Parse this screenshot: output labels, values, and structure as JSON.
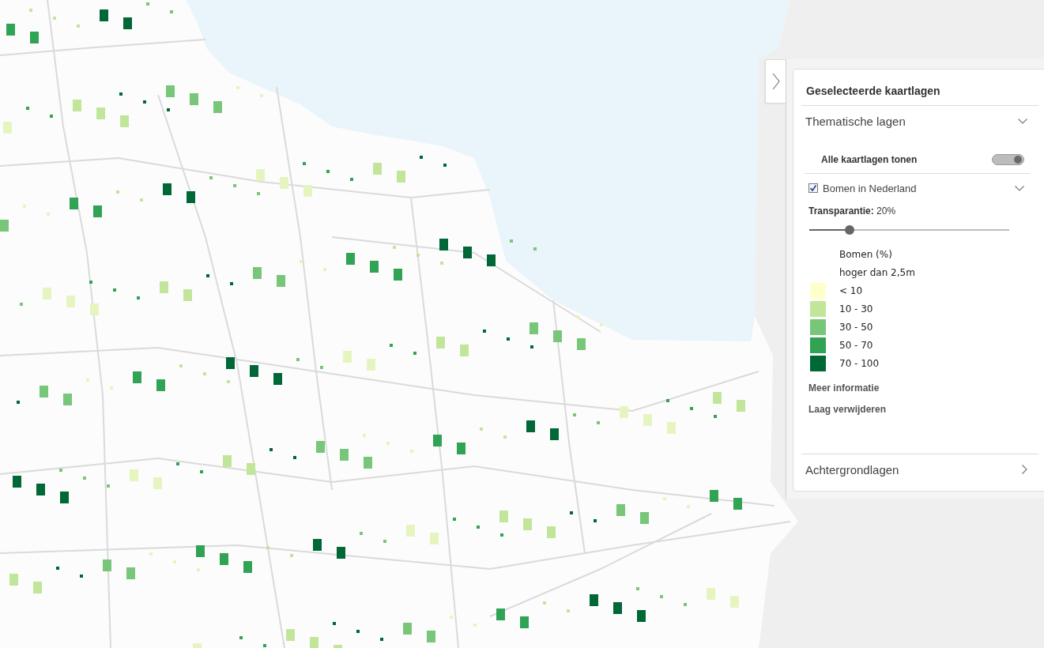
{
  "panel": {
    "title": "Geselecteerde kaartlagen",
    "sections": [
      {
        "label": "Thematische lagen",
        "expanded": true,
        "show_all": {
          "label": "Alle kaartlagen tonen",
          "on": true
        },
        "layers": [
          {
            "name": "Bomen in Nederland",
            "checked": true,
            "expanded": true,
            "transparency": "**Transparantie:** 20%",
            "level": 0.2,
            "legend": {
              "title": "Bomen (%)",
              "subtitle": "hoger dan 2,5m",
              "classes": [
                {
                  "label": "< 10",
                  "color": "#ffffcc"
                },
                {
                  "label": "10 - 30",
                  "color": "#c2e699"
                },
                {
                  "label": "30 - 50",
                  "color": "#78c679"
                },
                {
                  "label": "50 - 70",
                  "color": "#31a354"
                },
                {
                  "label": "70 - 100",
                  "color": "#006837"
                }
              ]
            },
            "actions": [
              "Meer informatie",
              "Laag verwijderen"
            ]
          }
        ]
      },
      {
        "label": "Achtergrondlagen",
        "expanded": false
      }
    ]
  }
}
